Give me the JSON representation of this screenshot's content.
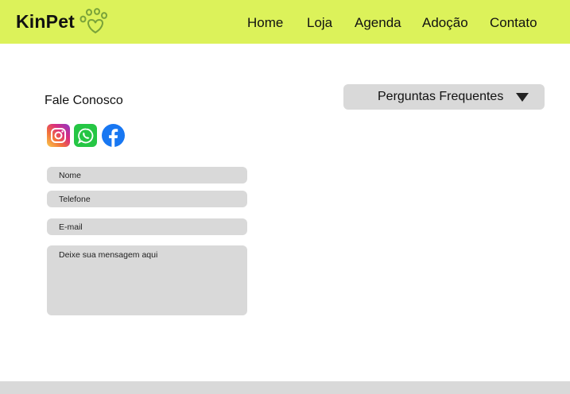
{
  "brand": {
    "name": "KinPet",
    "logo_icon": "paw-heart-icon",
    "accent_color": "#dcf25a"
  },
  "nav": {
    "items": [
      {
        "label": "Home"
      },
      {
        "label": "Loja"
      },
      {
        "label": "Agenda"
      },
      {
        "label": "Adoção"
      },
      {
        "label": "Contato"
      }
    ]
  },
  "contact": {
    "title": "Fale Conosco",
    "social": [
      {
        "icon": "instagram-icon"
      },
      {
        "icon": "whatsapp-icon"
      },
      {
        "icon": "facebook-icon"
      }
    ],
    "form": {
      "name_placeholder": "Nome",
      "phone_placeholder": "Telefone",
      "email_placeholder": "E-mail",
      "message_placeholder": "Deixe sua mensagem aqui"
    }
  },
  "faq": {
    "label": "Perguntas Frequentes",
    "icon": "triangle-down-icon"
  }
}
